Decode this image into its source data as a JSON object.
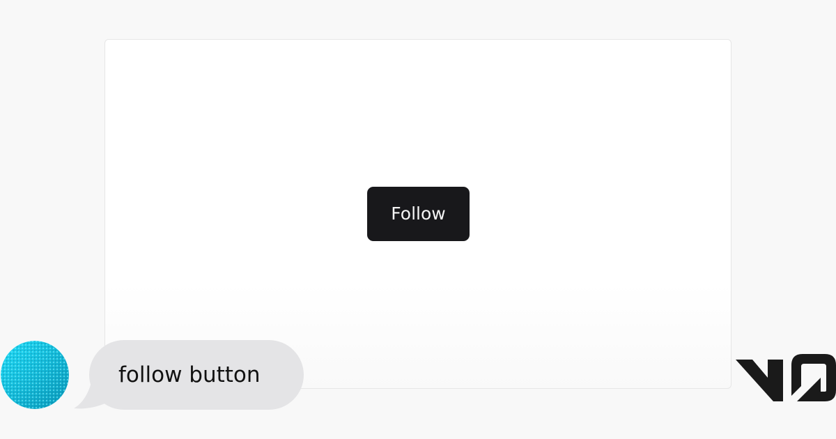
{
  "preview": {
    "button_label": "Follow"
  },
  "chat": {
    "message": "follow button"
  },
  "brand": {
    "logo_icon": "v0-logo-icon"
  },
  "colors": {
    "page_background": "#f8f8f8",
    "card_background": "#ffffff",
    "button_background": "#18181b",
    "button_text": "#f5f5f5",
    "bubble_background": "#e4e4e6",
    "avatar_gradient_start": "#1fd6f5",
    "avatar_gradient_end": "#0aa3c2",
    "logo": "#1a1a1a"
  }
}
